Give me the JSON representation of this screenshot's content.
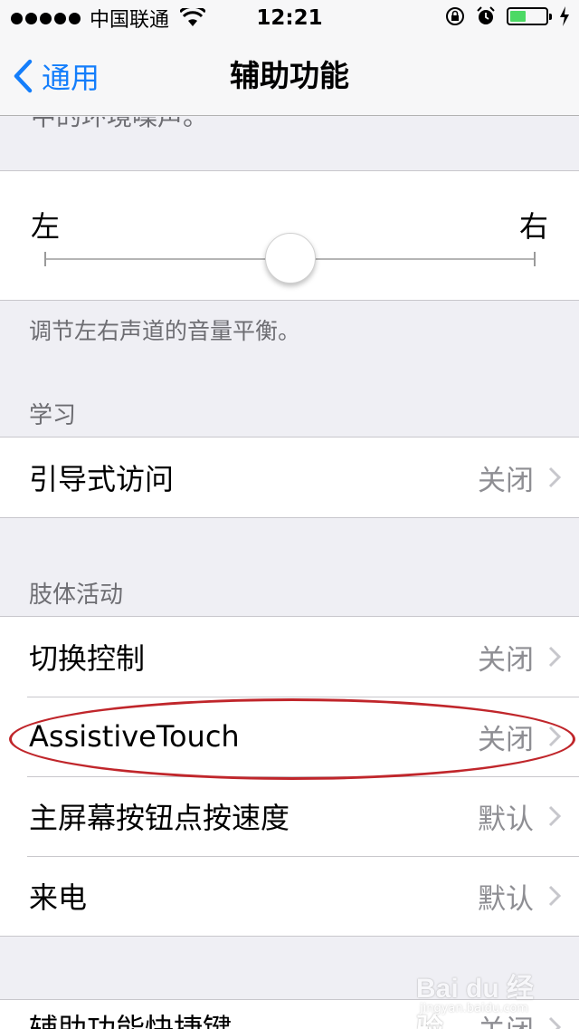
{
  "status_bar": {
    "carrier": "中国联通",
    "time": "12:21",
    "battery_level": 0.45
  },
  "nav": {
    "back_label": "通用",
    "title": "辅助功能"
  },
  "cutoff_text": "中的环境噪声。",
  "balance": {
    "left_label": "左",
    "right_label": "右",
    "value": 0.5,
    "footer": "调节左右声道的音量平衡。"
  },
  "learning": {
    "header": "学习",
    "items": [
      {
        "label": "引导式访问",
        "value": "关闭"
      }
    ]
  },
  "interaction": {
    "header": "肢体活动",
    "items": [
      {
        "label": "切换控制",
        "value": "关闭"
      },
      {
        "label": "AssistiveTouch",
        "value": "关闭"
      },
      {
        "label": "主屏幕按钮点按速度",
        "value": "默认"
      },
      {
        "label": "来电",
        "value": "默认"
      }
    ]
  },
  "bottom_item": {
    "label": "辅助功能快捷键",
    "value": "关闭"
  },
  "watermark": {
    "brand": "Bai du 经验",
    "url": "jingyan.baidu.com"
  },
  "colors": {
    "accent": "#147efb",
    "annotation": "#c0262b",
    "battery": "#4cd964"
  }
}
